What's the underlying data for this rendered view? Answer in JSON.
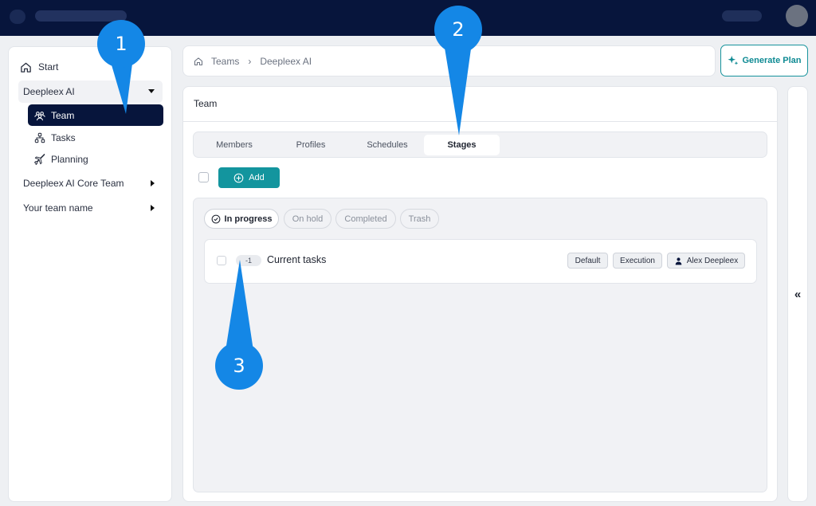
{
  "colors": {
    "topbar": "#07153c",
    "accent": "#13959e",
    "callout": "#1487e6",
    "selected_nav": "#07153c"
  },
  "sidebar": {
    "start": {
      "label": "Start",
      "icon": "home-icon"
    },
    "groups": [
      {
        "label": "Deepleex AI",
        "expanded": true,
        "items": [
          {
            "label": "Team",
            "icon": "team-icon",
            "selected": true
          },
          {
            "label": "Tasks",
            "icon": "tasks-icon"
          },
          {
            "label": "Planning",
            "icon": "plane-icon"
          }
        ]
      },
      {
        "label": "Deepleex AI Core Team",
        "expanded": false
      },
      {
        "label": "Your team name",
        "expanded": false
      }
    ]
  },
  "breadcrumb": {
    "items": [
      "Teams",
      "Deepleex AI"
    ]
  },
  "generate_plan": {
    "label": "Generate Plan"
  },
  "main": {
    "title": "Team",
    "tabs": [
      {
        "label": "Members"
      },
      {
        "label": "Profiles"
      },
      {
        "label": "Schedules"
      },
      {
        "label": "Stages",
        "active": true
      }
    ],
    "add_label": "Add",
    "filters": [
      {
        "label": "In progress",
        "active": true
      },
      {
        "label": "On hold"
      },
      {
        "label": "Completed"
      },
      {
        "label": "Trash"
      }
    ],
    "task": {
      "badge": "-1",
      "title": "Current tasks",
      "tags": [
        "Default",
        "Execution",
        "Alex Deepleex"
      ]
    }
  },
  "collapse": {
    "label": "«"
  },
  "callouts": [
    "1",
    "2",
    "3"
  ]
}
